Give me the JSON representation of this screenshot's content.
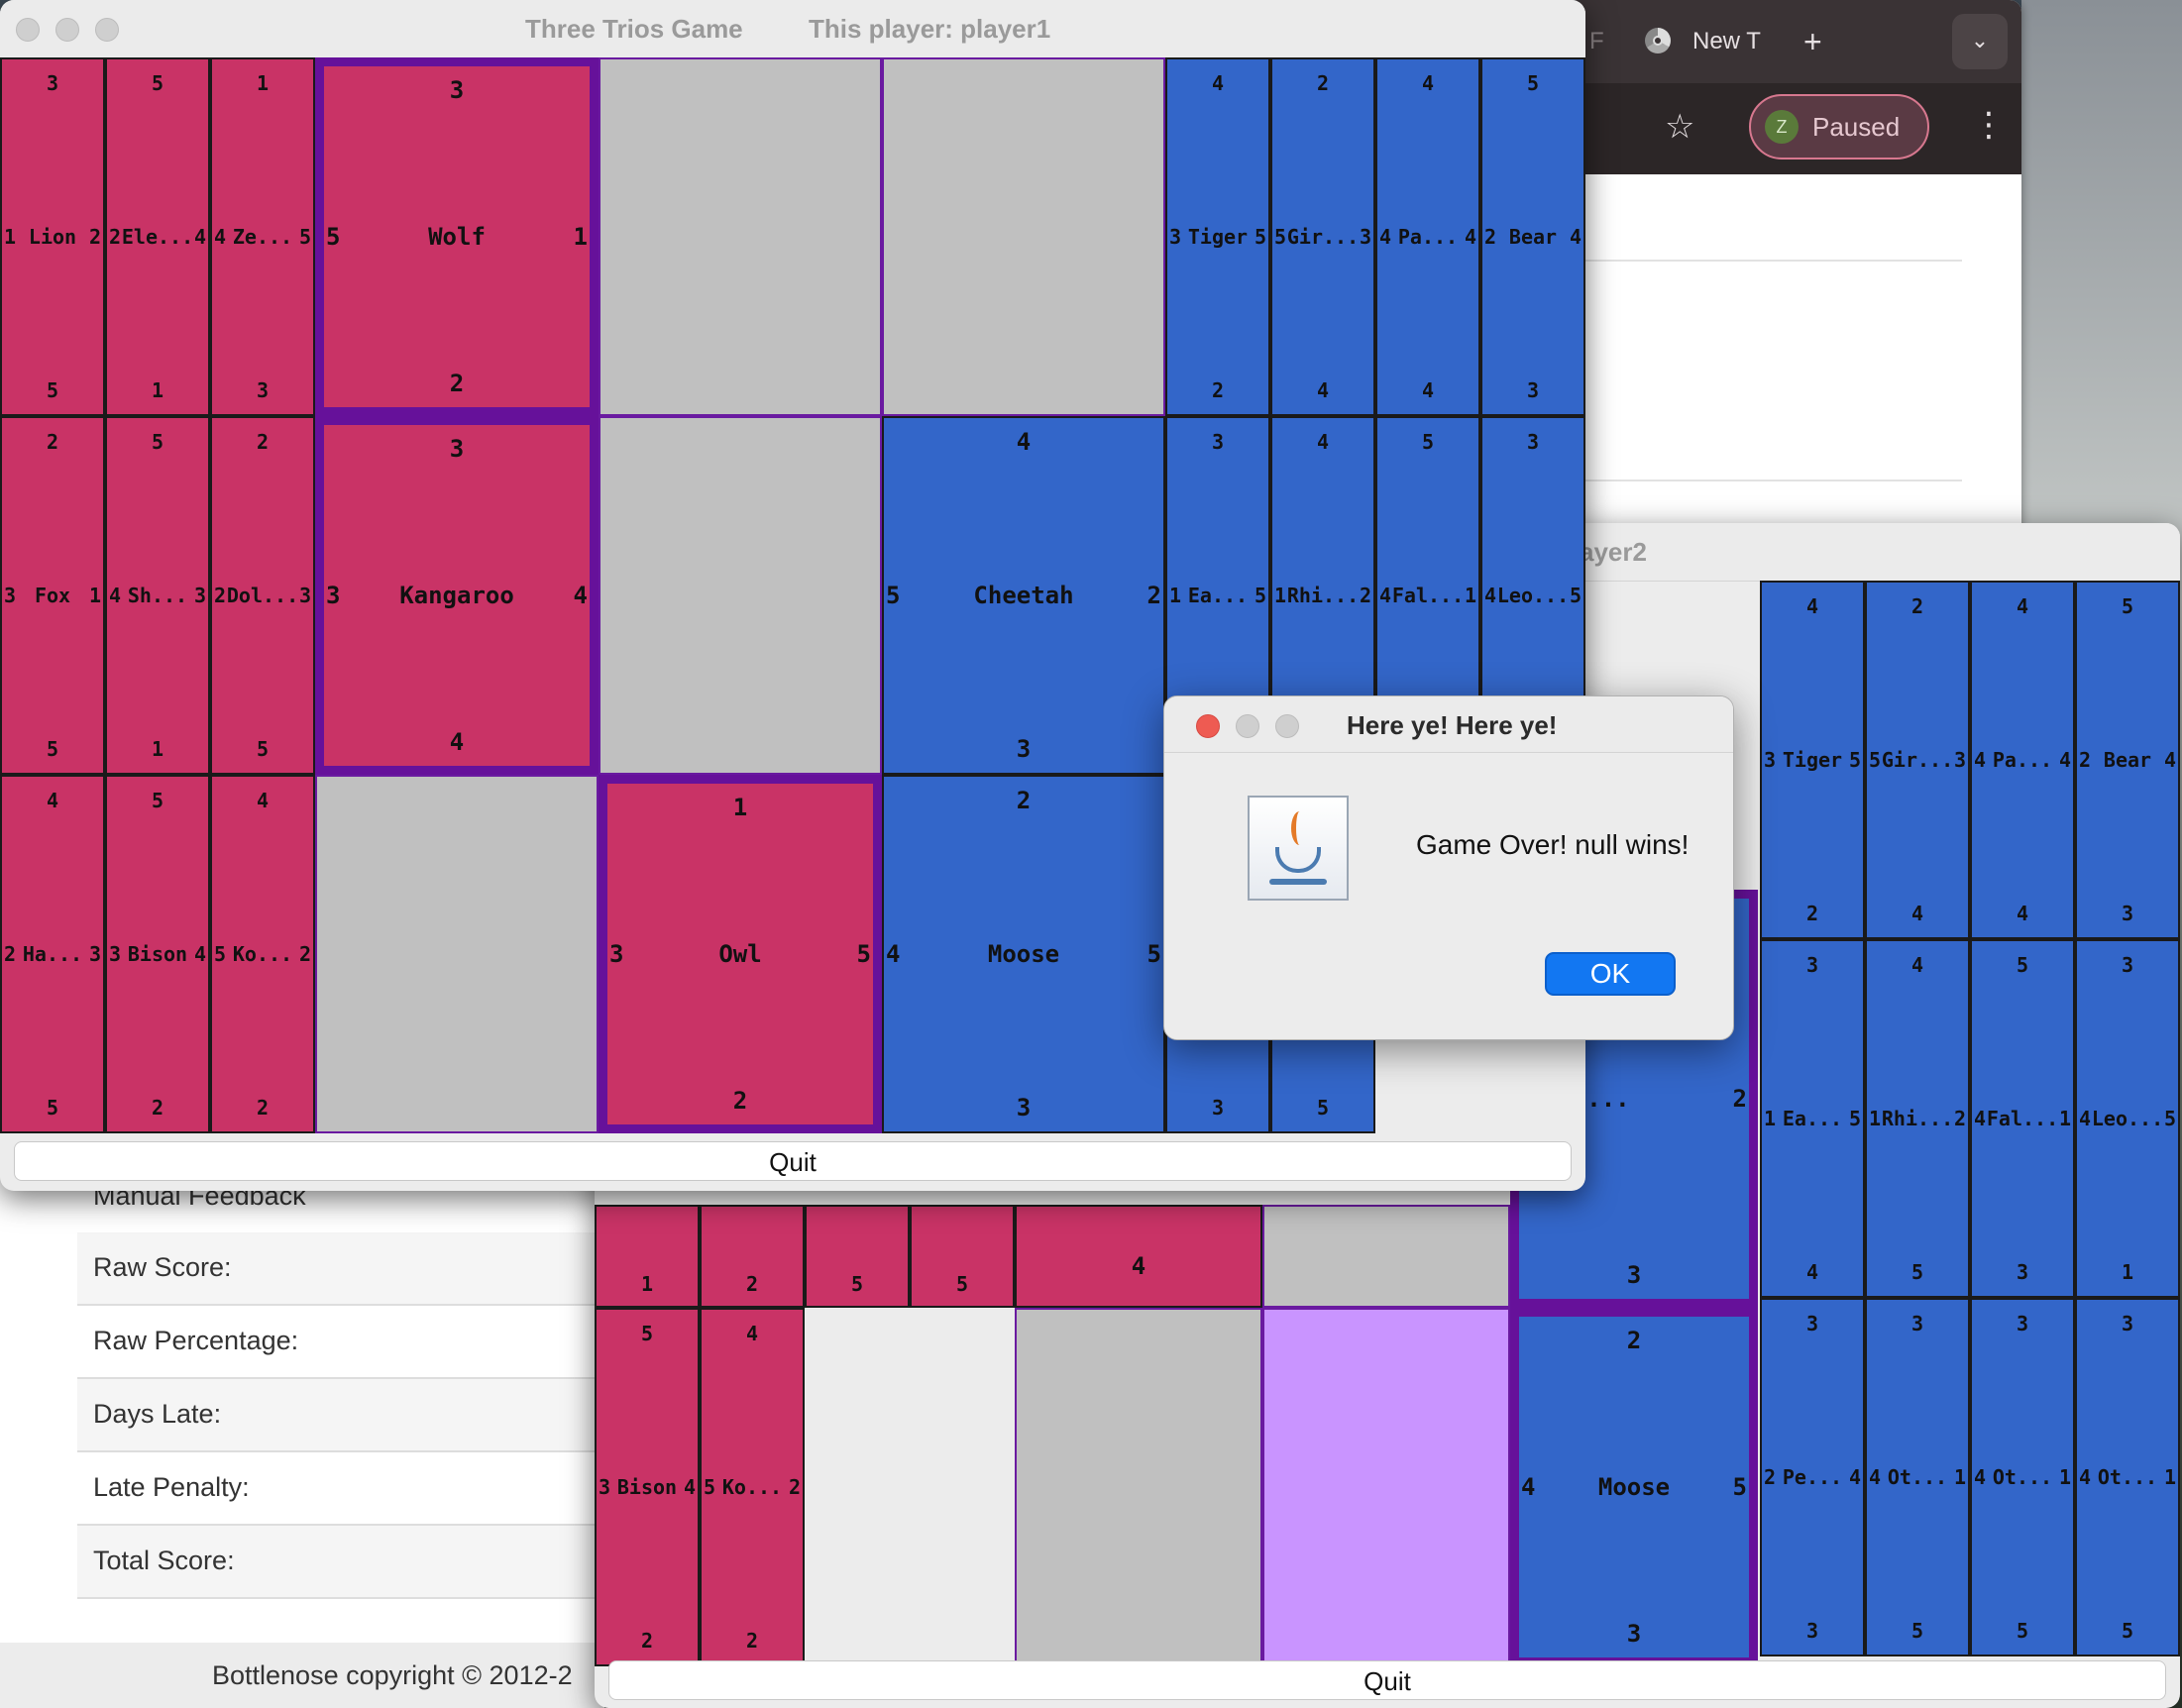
{
  "chrome": {
    "tab_partial": "F",
    "new_tab_label": "New T",
    "plus": "+",
    "dropdown": "⌄",
    "star": "☆",
    "profile_initial": "Z",
    "profile_status": "Paused",
    "menu": "⋮"
  },
  "bottlenose": {
    "rows": [
      "Manual Feedback",
      "Raw Score:",
      "Raw Percentage:",
      "Days Late:",
      "Late Penalty:",
      "Total Score:"
    ],
    "footer": "Bottlenose copyright © 2012-2"
  },
  "window1": {
    "title": "Three Trios Game",
    "player_label": "This player: player1",
    "quit_label": "Quit",
    "hand_left": [
      {
        "name": "Lion",
        "n": "3",
        "s": "5",
        "w": "1",
        "e": "2"
      },
      {
        "name": "Ele...",
        "n": "5",
        "s": "1",
        "w": "2",
        "e": "4"
      },
      {
        "name": "Ze...",
        "n": "1",
        "s": "3",
        "w": "4",
        "e": "5"
      },
      {
        "name": "Fox",
        "n": "2",
        "s": "5",
        "w": "3",
        "e": "1"
      },
      {
        "name": "Sh...",
        "n": "5",
        "s": "1",
        "w": "4",
        "e": "3"
      },
      {
        "name": "Dol...",
        "n": "2",
        "s": "5",
        "w": "2",
        "e": "3"
      },
      {
        "name": "Ha...",
        "n": "4",
        "s": "5",
        "w": "2",
        "e": "3"
      },
      {
        "name": "Bison",
        "n": "5",
        "s": "2",
        "w": "3",
        "e": "4"
      },
      {
        "name": "Ko...",
        "n": "4",
        "s": "2",
        "w": "5",
        "e": "2"
      }
    ],
    "board": [
      {
        "name": "Wolf",
        "n": "3",
        "s": "2",
        "w": "5",
        "e": "1"
      },
      {
        "name": "Kangaroo",
        "n": "3",
        "s": "4",
        "w": "3",
        "e": "4"
      },
      {
        "name": "Cheetah",
        "n": "4",
        "s": "3",
        "w": "5",
        "e": "2"
      },
      {
        "name": "Owl",
        "n": "1",
        "s": "2",
        "w": "3",
        "e": "5"
      },
      {
        "name": "Moose",
        "n": "2",
        "s": "3",
        "w": "4",
        "e": "5"
      }
    ],
    "hand_right": [
      {
        "name": "Tiger",
        "n": "4",
        "s": "2",
        "w": "3",
        "e": "5"
      },
      {
        "name": "Gir...",
        "n": "2",
        "s": "4",
        "w": "5",
        "e": "3"
      },
      {
        "name": "Pa...",
        "n": "4",
        "s": "4",
        "w": "4",
        "e": "4"
      },
      {
        "name": "Bear",
        "n": "5",
        "s": "3",
        "w": "2",
        "e": "4"
      },
      {
        "name": "Ea...",
        "n": "3",
        "s": "",
        "w": "1",
        "e": "5"
      },
      {
        "name": "Rhi...",
        "n": "4",
        "s": "",
        "w": "1",
        "e": "2"
      },
      {
        "name": "Fal...",
        "n": "5",
        "s": "",
        "w": "4",
        "e": "1"
      },
      {
        "name": "Leo...",
        "n": "3",
        "s": "",
        "w": "4",
        "e": "5"
      }
    ],
    "hand_right_bottom": [
      "3",
      "5"
    ]
  },
  "window2": {
    "title_partial": "ayer2",
    "quit_label": "Quit",
    "red_strip": [
      "1",
      "2",
      "5",
      "5"
    ],
    "red_strip_big": "4",
    "hand_left": [
      {
        "name": "Bison",
        "n": "5",
        "s": "2",
        "w": "3",
        "e": "4"
      },
      {
        "name": "Ko...",
        "n": "4",
        "s": "2",
        "w": "5",
        "e": "2"
      }
    ],
    "cheetah": {
      "name": "Cheet...",
      "s": "3",
      "e": "2"
    },
    "moose": {
      "name": "Moose",
      "n": "2",
      "s": "3",
      "w": "4",
      "e": "5"
    },
    "hand_right": [
      {
        "name": "Tiger",
        "n": "4",
        "s": "2",
        "w": "3",
        "e": "5"
      },
      {
        "name": "Gir...",
        "n": "2",
        "s": "4",
        "w": "5",
        "e": "3"
      },
      {
        "name": "Pa...",
        "n": "4",
        "s": "4",
        "w": "4",
        "e": "4"
      },
      {
        "name": "Bear",
        "n": "5",
        "s": "3",
        "w": "2",
        "e": "4"
      },
      {
        "name": "Ea...",
        "n": "3",
        "s": "4",
        "w": "1",
        "e": "5"
      },
      {
        "name": "Rhi...",
        "n": "4",
        "s": "5",
        "w": "1",
        "e": "2"
      },
      {
        "name": "Fal...",
        "n": "5",
        "s": "3",
        "w": "4",
        "e": "1"
      },
      {
        "name": "Leo...",
        "n": "3",
        "s": "1",
        "w": "4",
        "e": "5"
      },
      {
        "name": "Pe...",
        "n": "3",
        "s": "3",
        "w": "2",
        "e": "4"
      },
      {
        "name": "Ot...",
        "n": "3",
        "s": "5",
        "w": "4",
        "e": "1"
      },
      {
        "name": "Ot...",
        "n": "3",
        "s": "5",
        "w": "4",
        "e": "1"
      },
      {
        "name": "Ot...",
        "n": "3",
        "s": "5",
        "w": "4",
        "e": "1"
      }
    ]
  },
  "dialog": {
    "title": "Here ye! Here ye!",
    "message": "Game Over! null wins!",
    "ok_label": "OK"
  },
  "colors": {
    "red_player": "#c93366",
    "blue_player": "#3366c9",
    "selected_border": "#66119a",
    "empty_cell": "#c0c0c0",
    "highlight": "#c994ff",
    "ok_button": "#1277f2"
  }
}
